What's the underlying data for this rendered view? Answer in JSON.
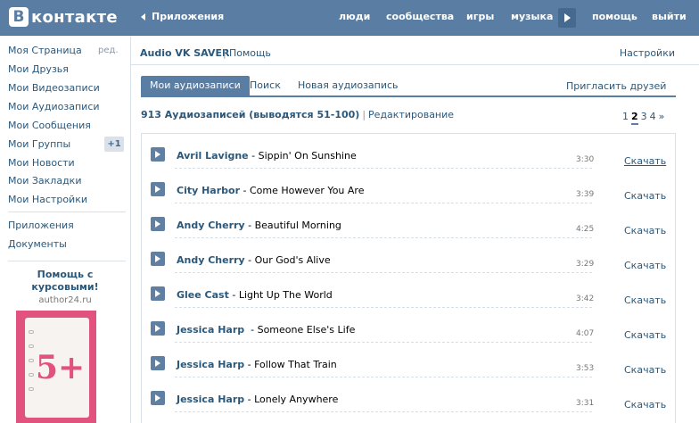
{
  "header": {
    "logo_letter": "В",
    "logo_text": "контакте",
    "crumb": "Приложения",
    "nav": [
      "люди",
      "сообщества",
      "игры",
      "музыка",
      "помощь",
      "выйти"
    ]
  },
  "sidebar": {
    "items": [
      "Моя Страница",
      "Мои Друзья",
      "Мои Видеозаписи",
      "Мои Аудиозаписи",
      "Мои Сообщения",
      "Мои Группы",
      "Мои Новости",
      "Мои Закладки",
      "Мои Настройки"
    ],
    "edit_label": "ред.",
    "groups_badge": "+1",
    "extra": [
      "Приложения",
      "Документы"
    ],
    "ad": {
      "title_line1": "Помощь с",
      "title_line2": "курсовыми!",
      "domain": "author24.ru",
      "grade": "5+"
    }
  },
  "main": {
    "app_name": "Audio VK SAVER",
    "divider": "|",
    "help": "Помощь",
    "settings": "Настройки",
    "tabs": [
      "Мои аудиозаписи",
      "Поиск",
      "Новая аудиозапись"
    ],
    "invite": "Пригласить друзей",
    "count_text": "913 Аудиозаписей (выводятся 51-100)",
    "edit": "Редактирование",
    "pager": [
      "1",
      "2",
      "3",
      "4",
      "»"
    ],
    "tracks": [
      {
        "artist": "Avril Lavigne",
        "dash": " - ",
        "title": "Sippin' On Sunshine",
        "duration": "3:30",
        "download": "Скачать"
      },
      {
        "artist": "City Harbor",
        "dash": " - ",
        "title": "Come However You Are",
        "duration": "3:39",
        "download": "Скачать"
      },
      {
        "artist": "Andy Cherry",
        "dash": " - ",
        "title": "Beautiful Morning",
        "duration": "4:25",
        "download": "Скачать"
      },
      {
        "artist": "Andy Cherry",
        "dash": " - ",
        "title": "Our God's Alive",
        "duration": "3:29",
        "download": "Скачать"
      },
      {
        "artist": "Glee Cast",
        "dash": " - ",
        "title": "Light Up The World",
        "duration": "3:42",
        "download": "Скачать"
      },
      {
        "artist": "Jessica Harp",
        "dash": "  - ",
        "title": "Someone Else's Life",
        "duration": "4:07",
        "download": "Скачать"
      },
      {
        "artist": "Jessica Harp",
        "dash": " - ",
        "title": "Follow That Train",
        "duration": "3:53",
        "download": "Скачать"
      },
      {
        "artist": "Jessica Harp",
        "dash": " - ",
        "title": "Lonely Anywhere",
        "duration": "3:31",
        "download": "Скачать"
      }
    ]
  },
  "colors": {
    "header_bg": "#597da3",
    "link": "#2b587a",
    "ad_bg": "#e2527f"
  },
  "icons": {
    "play": "play-icon",
    "back": "back-arrow-icon"
  }
}
